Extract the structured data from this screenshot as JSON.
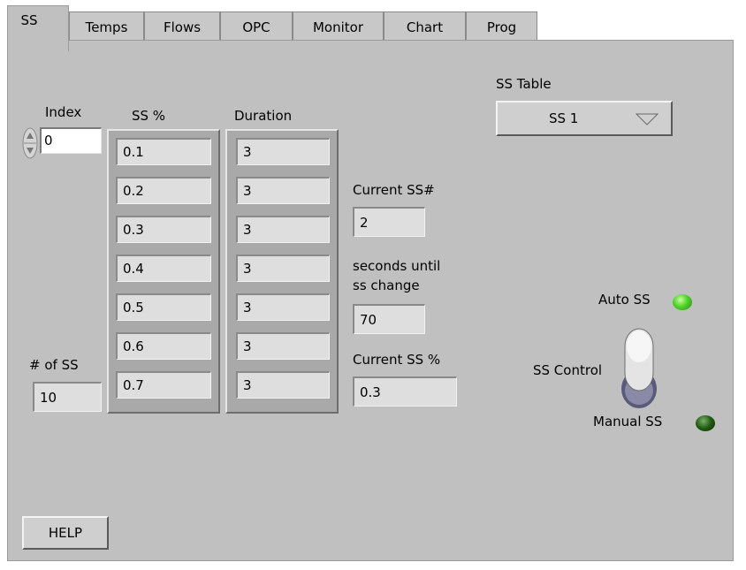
{
  "tabs": [
    {
      "label": "SS",
      "active": true
    },
    {
      "label": "Temps",
      "active": false
    },
    {
      "label": "Flows",
      "active": false
    },
    {
      "label": "OPC",
      "active": false
    },
    {
      "label": "Monitor",
      "active": false
    },
    {
      "label": "Chart",
      "active": false
    },
    {
      "label": "Prog",
      "active": false
    }
  ],
  "index": {
    "label": "Index",
    "value": "0"
  },
  "ss_pct": {
    "header": "SS %",
    "values": [
      "0.1",
      "0.2",
      "0.3",
      "0.4",
      "0.5",
      "0.6",
      "0.7"
    ]
  },
  "duration": {
    "header": "Duration",
    "values": [
      "3",
      "3",
      "3",
      "3",
      "3",
      "3",
      "3"
    ]
  },
  "num_ss": {
    "label": "# of SS",
    "value": "10"
  },
  "current_ss_num": {
    "label": "Current SS#",
    "value": "2"
  },
  "seconds_until": {
    "label_line1": "seconds until",
    "label_line2": "ss change",
    "value": "70"
  },
  "current_ss_pct": {
    "label": "Current SS %",
    "value": "0.3"
  },
  "ss_table": {
    "label": "SS Table",
    "selected": "SS 1"
  },
  "ss_control": {
    "label": "SS Control",
    "auto_label": "Auto SS",
    "manual_label": "Manual SS",
    "auto_led_color": "#4fd22a",
    "manual_led_color": "#1f5a10"
  },
  "help": {
    "label": "HELP"
  }
}
